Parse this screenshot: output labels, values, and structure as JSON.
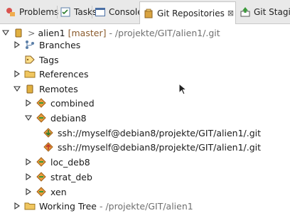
{
  "tabs": [
    {
      "label": "Problems",
      "icon": "problems-icon",
      "active": false
    },
    {
      "label": "Tasks",
      "icon": "tasks-icon",
      "active": false
    },
    {
      "label": "Console",
      "icon": "console-icon",
      "active": false
    },
    {
      "label": "Git Repositories",
      "icon": "git-repositories-icon",
      "active": true,
      "close": "⊠"
    },
    {
      "label": "Git Staging",
      "icon": "git-staging-icon",
      "active": false
    }
  ],
  "tree": {
    "repository": {
      "prefix": ">",
      "name": "alien1",
      "branch": "[master]",
      "path": "- /projekte/GIT/alien1/.git"
    },
    "branches": "Branches",
    "tags": "Tags",
    "references": "References",
    "remotes": "Remotes",
    "remote_items": {
      "combined": "combined",
      "debian8": "debian8",
      "debian8_fetch": "ssh://myself@debian8/projekte/GIT/alien1/.git",
      "debian8_push": "ssh://myself@debian8/projekte/GIT/alien1/.git",
      "loc_deb8": "loc_deb8",
      "strat_deb": "strat_deb",
      "xen": "xen"
    },
    "working_tree": {
      "label": "Working Tree",
      "path": "- /projekte/GIT/alien1"
    }
  }
}
